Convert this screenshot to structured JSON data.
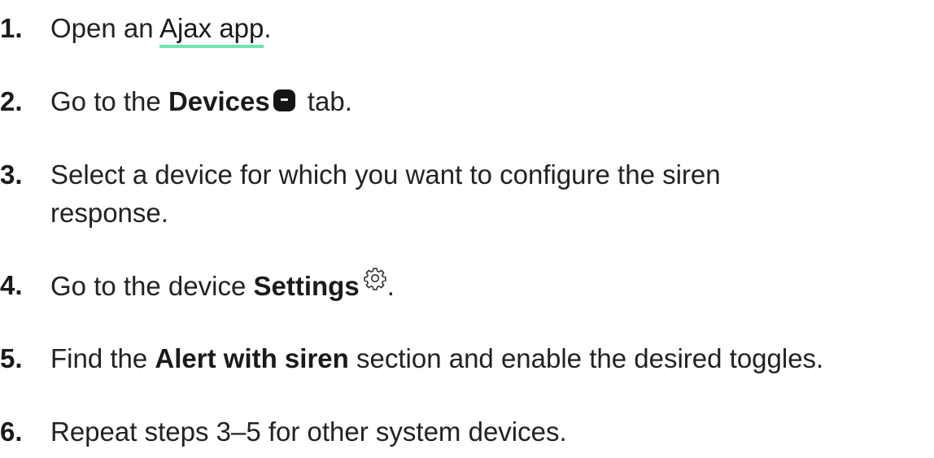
{
  "steps": [
    {
      "number": "1.",
      "before": "Open an",
      "link": "Ajax app",
      "after": "."
    },
    {
      "number": "2.",
      "before": "Go to the",
      "bold": "Devices",
      "icon": "devices-tab-icon",
      "after": "tab."
    },
    {
      "number": "3.",
      "text": "Select a device for which you want to configure the siren response."
    },
    {
      "number": "4.",
      "before": "Go to the device",
      "bold": "Settings",
      "icon": "gear-icon",
      "after": "."
    },
    {
      "number": "5.",
      "before": "Find the",
      "bold": "Alert with siren",
      "after": "section and enable the desired toggles."
    },
    {
      "number": "6.",
      "text": "Repeat steps 3–5 for other system devices."
    }
  ],
  "colors": {
    "link_underline": "#6fe3b3",
    "text": "#222222",
    "icon": "#151515"
  }
}
